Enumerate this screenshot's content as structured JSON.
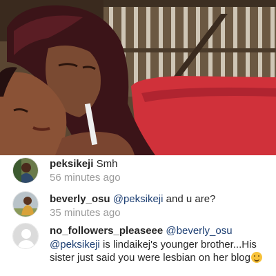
{
  "post": {
    "image_icon": "photo-of-two-women"
  },
  "comments": [
    {
      "username": "peksikeji",
      "text": "Smh",
      "time": "56 minutes ago",
      "avatar_icon": "user-avatar-photo"
    },
    {
      "username": "beverly_osu",
      "mention": "@peksikeji",
      "text": "and u are?",
      "time": "35 minutes ago",
      "avatar_icon": "user-avatar-photo"
    },
    {
      "username": "no_followers_pleaseee",
      "mention1": "@beverly_osu",
      "mention2": "@peksikeji",
      "text": "is lindaikej's younger brother...His sister just said you were lesbian on her blog",
      "emoji_icon": "smiling-emoji-icon",
      "avatar_icon": "default-avatar-icon"
    }
  ],
  "colors": {
    "mention": "#1d3f73",
    "timestamp": "#9a9a9a",
    "username": "#262626"
  }
}
